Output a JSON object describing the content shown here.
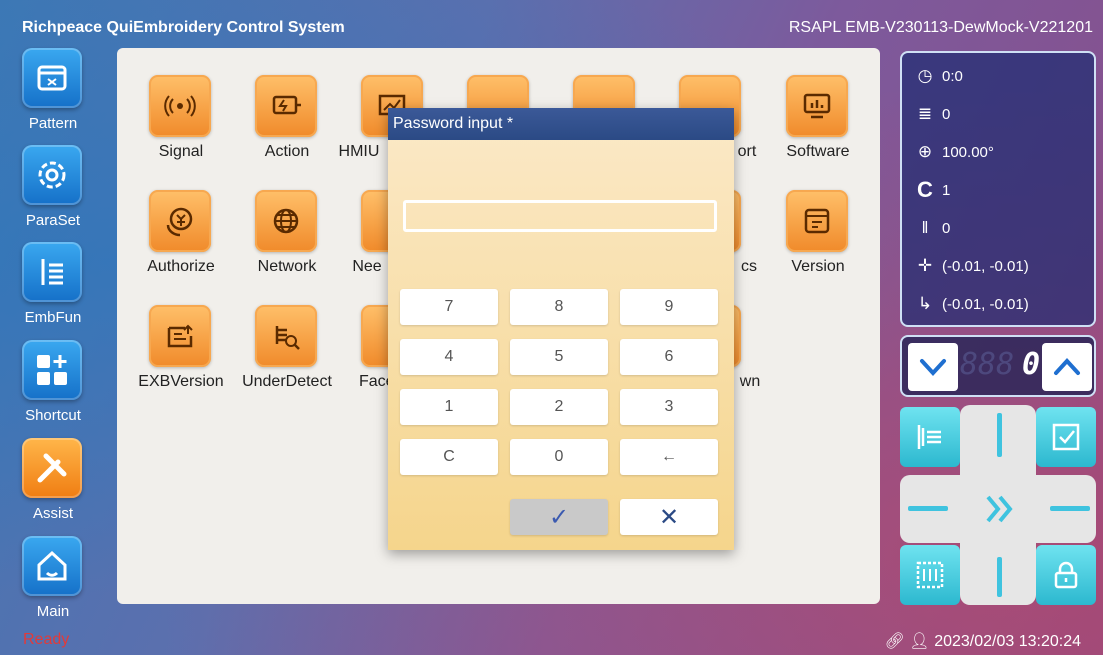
{
  "app": {
    "title": "Richpeace QuiEmbroidery Control System",
    "version": "RSAPL EMB-V230113-DewMock-V221201"
  },
  "nav": [
    {
      "label": "Pattern",
      "icon": "pattern-folder-icon"
    },
    {
      "label": "ParaSet",
      "icon": "gear-icon"
    },
    {
      "label": "EmbFun",
      "icon": "embroidery-icon"
    },
    {
      "label": "Shortcut",
      "icon": "shortcut-grid-icon"
    },
    {
      "label": "Assist",
      "icon": "tools-icon"
    },
    {
      "label": "Main",
      "icon": "home-icon"
    }
  ],
  "tiles": [
    {
      "label": "Signal",
      "icon": "signal-icon"
    },
    {
      "label": "Action",
      "icon": "action-icon"
    },
    {
      "label": "HMIU",
      "icon": "hmi-upgrade-icon"
    },
    {
      "label": "",
      "icon": "upload-icon"
    },
    {
      "label": "",
      "icon": "clipboard-icon"
    },
    {
      "label": "ort",
      "icon": "clipboard-icon"
    },
    {
      "label": "Software",
      "icon": "software-icon"
    },
    {
      "label": "Authorize",
      "icon": "authorize-icon"
    },
    {
      "label": "Network",
      "icon": "network-icon"
    },
    {
      "label": "Nee",
      "icon": "needle-icon"
    },
    {
      "label": "cs",
      "icon": "diagnostics-icon"
    },
    {
      "label": "Version",
      "icon": "version-icon"
    },
    {
      "label": "EXBVersion",
      "icon": "exb-version-icon"
    },
    {
      "label": "UnderDetect",
      "icon": "under-detect-icon"
    },
    {
      "label": "FaceI",
      "icon": "face-icon"
    },
    {
      "label": "wn",
      "icon": "shutdown-icon"
    }
  ],
  "dialog": {
    "title": "Password input *",
    "input_value": "",
    "keys": [
      "7",
      "8",
      "9",
      "4",
      "5",
      "6",
      "1",
      "2",
      "3",
      "C",
      "0",
      "←"
    ],
    "confirm_label": "✓",
    "cancel_label": "✕"
  },
  "info": {
    "time": "0:0",
    "stitches": "0",
    "speed": "100.00°",
    "color": "1",
    "needle": "0",
    "position": "(-0.01, -0.01)",
    "origin": "(-0.01, -0.01)"
  },
  "counter": {
    "value": "0",
    "ghost": "888"
  },
  "status": {
    "state": "Ready",
    "datetime": "2023/02/03 13:20:24"
  },
  "colors": {
    "accent_orange": "#f08a2a",
    "nav_blue": "#1570c8",
    "cyan": "#2cb8cf",
    "status_red": "#e23a3a"
  }
}
